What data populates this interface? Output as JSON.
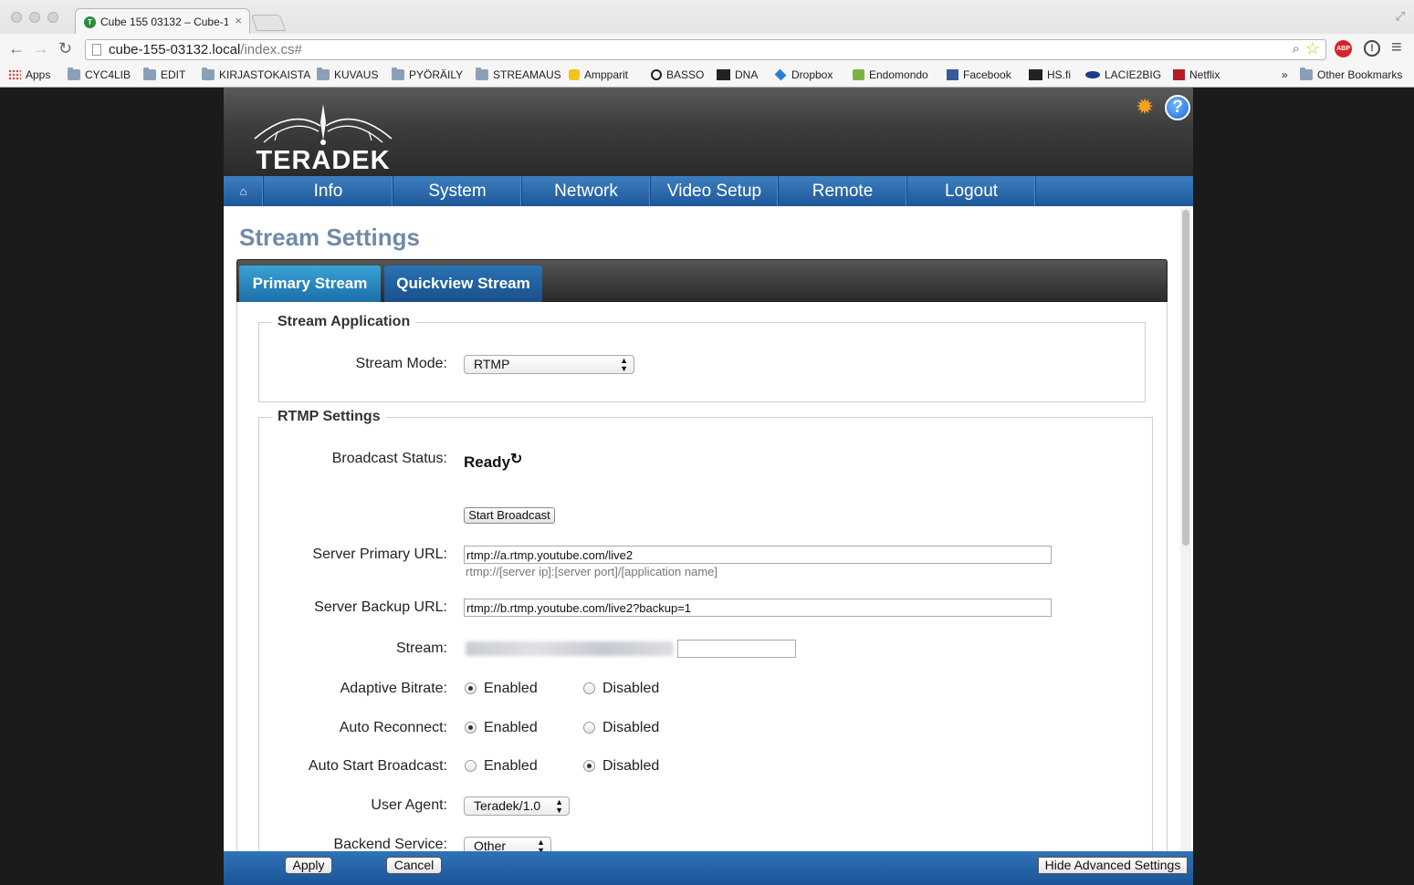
{
  "browser": {
    "tab_title": "Cube 155 03132 – Cube-1",
    "tab_close": "×",
    "url_host": "cube-155-03132.local",
    "url_path": "/index.cs#",
    "bookmarks": [
      {
        "label": "Apps",
        "icon": "apps-icon"
      },
      {
        "label": "CYC4LIB",
        "icon": "folder-icon"
      },
      {
        "label": "EDIT",
        "icon": "folder-icon"
      },
      {
        "label": "KIRJASTOKAISTA",
        "icon": "folder-icon"
      },
      {
        "label": "KUVAUS",
        "icon": "folder-icon"
      },
      {
        "label": "PYÖRÄILY",
        "icon": "folder-icon"
      },
      {
        "label": "STREAMAUS",
        "icon": "folder-icon"
      },
      {
        "label": "Ampparit",
        "icon": "ampparit-icon"
      },
      {
        "label": "BASSO",
        "icon": "basso-icon"
      },
      {
        "label": "DNA",
        "icon": "dna-icon"
      },
      {
        "label": "Dropbox",
        "icon": "dropbox-icon"
      },
      {
        "label": "Endomondo",
        "icon": "endomondo-icon"
      },
      {
        "label": "Facebook",
        "icon": "facebook-icon"
      },
      {
        "label": "HS.fi",
        "icon": "hs-icon"
      },
      {
        "label": "LACIE2BIG",
        "icon": "lacie-icon"
      },
      {
        "label": "Netflix",
        "icon": "netflix-icon"
      }
    ],
    "bookmarks_overflow": "»",
    "other_bookmarks": "Other Bookmarks",
    "abp_label": "ABP"
  },
  "app": {
    "logo_text": "TERADEK",
    "nav": [
      "Info",
      "System",
      "Network",
      "Video Setup",
      "Remote",
      "Logout"
    ],
    "page_title": "Stream Settings",
    "tabs": [
      "Primary Stream",
      "Quickview Stream"
    ],
    "stream_application": {
      "legend": "Stream Application",
      "mode_label": "Stream Mode:",
      "mode_value": "RTMP"
    },
    "rtmp": {
      "legend": "RTMP Settings",
      "broadcast_status_label": "Broadcast Status:",
      "broadcast_status_value": "Ready",
      "start_button": "Start Broadcast",
      "primary_url_label": "Server Primary URL:",
      "primary_url_value": "rtmp://a.rtmp.youtube.com/live2",
      "primary_url_hint": "rtmp://[server ip]:[server port]/[application name]",
      "backup_url_label": "Server Backup URL:",
      "backup_url_value": "rtmp://b.rtmp.youtube.com/live2?backup=1",
      "stream_label": "Stream:",
      "adaptive_label": "Adaptive Bitrate:",
      "reconnect_label": "Auto Reconnect:",
      "autostart_label": "Auto Start Broadcast:",
      "enabled": "Enabled",
      "disabled": "Disabled",
      "user_agent_label": "User Agent:",
      "user_agent_value": "Teradek/1.0",
      "backend_label": "Backend Service:",
      "backend_value": "Other"
    },
    "footer": {
      "apply": "Apply",
      "cancel": "Cancel",
      "hide_advanced": "Hide Advanced Settings"
    }
  },
  "colors": {
    "nav_blue": "#1d5799",
    "title_blue": "#6f8aa6",
    "tab_active": "#3aa2d6",
    "gear": "#f6a11a"
  }
}
